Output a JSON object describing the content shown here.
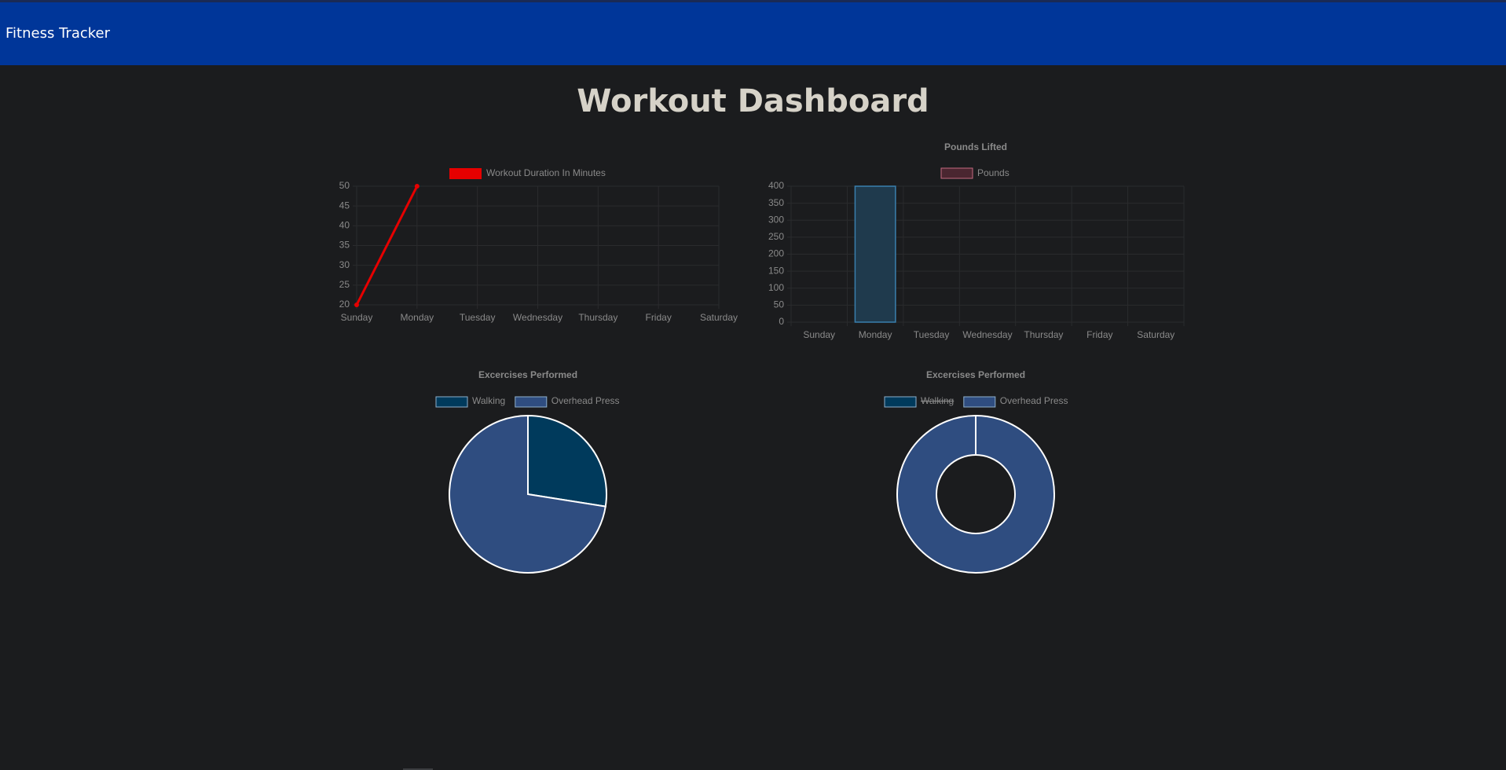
{
  "app": {
    "brand": "Fitness Tracker"
  },
  "page": {
    "title": "Workout Dashboard"
  },
  "colors": {
    "navbar": "#003699",
    "background": "#1b1c1e",
    "line_series": "#e60000",
    "bar_fill": "#1f3a4d",
    "bar_border": "#3a7fae",
    "pounds_legend_fill": "#4a2630",
    "pounds_legend_border": "#c46a80",
    "walking": "#003a5c",
    "overhead_press": "#2f4d80",
    "slice_border": "#ffffff",
    "text": "#8a8a8a",
    "grid": "#2a2b2d"
  },
  "chart_data": [
    {
      "type": "line",
      "title": "",
      "categories": [
        "Sunday",
        "Monday",
        "Tuesday",
        "Wednesday",
        "Thursday",
        "Friday",
        "Saturday"
      ],
      "series": [
        {
          "name": "Workout Duration In Minutes",
          "values": [
            20,
            50
          ]
        }
      ],
      "ylim": [
        20,
        50
      ],
      "yticks": [
        50,
        45,
        40,
        35,
        30,
        25,
        20
      ],
      "grid": true,
      "legend": "top"
    },
    {
      "type": "bar",
      "title": "Pounds Lifted",
      "categories": [
        "Sunday",
        "Monday",
        "Tuesday",
        "Wednesday",
        "Thursday",
        "Friday",
        "Saturday"
      ],
      "series": [
        {
          "name": "Pounds",
          "values": [
            0,
            400,
            0,
            0,
            0,
            0,
            0
          ]
        }
      ],
      "ylim": [
        0,
        400
      ],
      "yticks": [
        400,
        350,
        300,
        250,
        200,
        150,
        100,
        50,
        0
      ],
      "grid": true,
      "legend": "top"
    },
    {
      "type": "pie",
      "title": "Excercises Performed",
      "labels": [
        "Walking",
        "Overhead Press"
      ],
      "values": [
        27.5,
        72.5
      ],
      "legend": "top"
    },
    {
      "type": "pie",
      "variant": "doughnut",
      "title": "Excercises Performed",
      "labels": [
        "Walking",
        "Overhead Press"
      ],
      "values": [
        0,
        100
      ],
      "hidden": [
        "Walking"
      ],
      "legend": "top"
    }
  ]
}
